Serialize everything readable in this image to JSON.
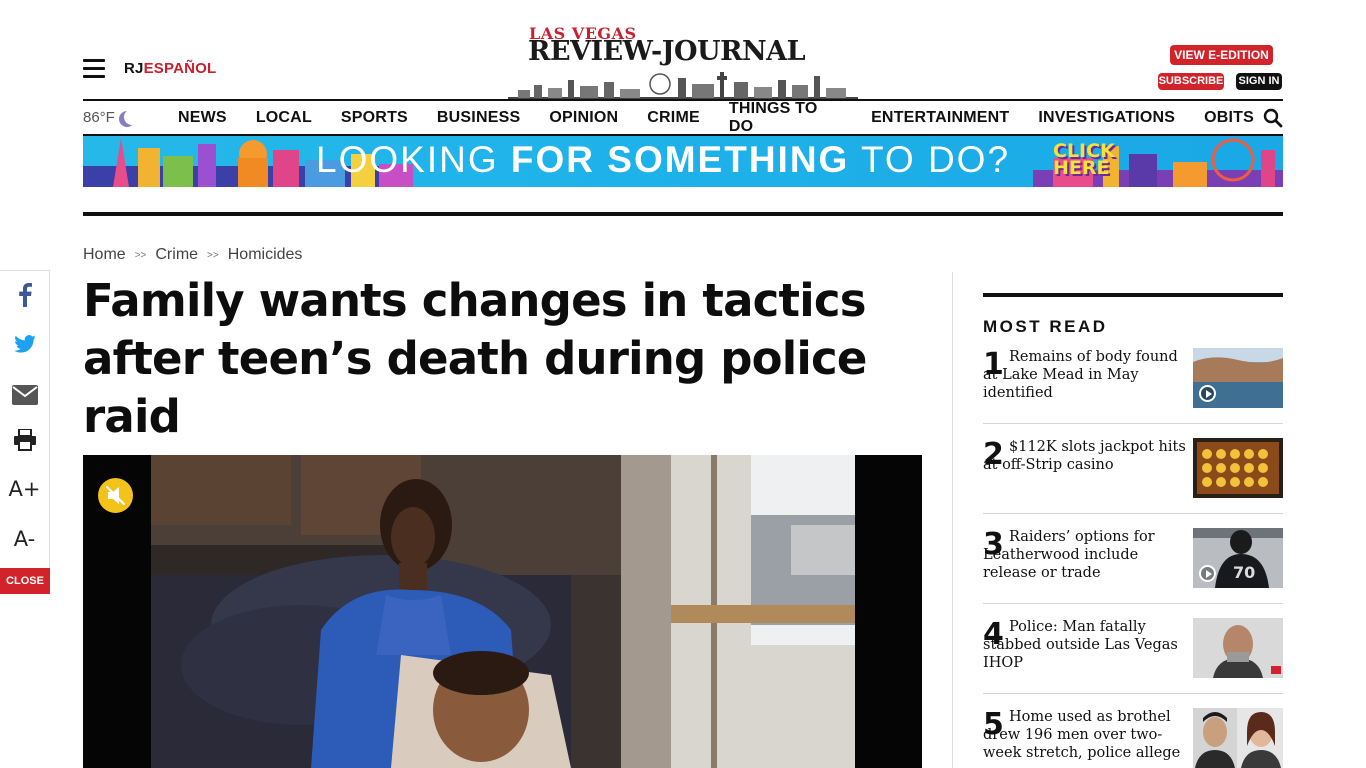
{
  "header": {
    "menu_icon": "hamburger-menu-icon",
    "rj": "RJ",
    "espanol": "ESPAÑOL",
    "logo_top": "LAS VEGAS",
    "logo_main": "REVIEW-JOURNAL",
    "view_eedition": "VIEW E-EDITION",
    "subscribe": "SUBSCRIBE",
    "sign_in": "SIGN IN"
  },
  "nav": {
    "weather": "86°F",
    "weather_icon": "moon-icon",
    "items": [
      "NEWS",
      "LOCAL",
      "SPORTS",
      "BUSINESS",
      "OPINION",
      "CRIME",
      "THINGS TO DO",
      "ENTERTAINMENT",
      "INVESTIGATIONS",
      "OBITS"
    ],
    "search_icon": "search-icon"
  },
  "banner": {
    "text_light_1": "LOOKING ",
    "text_bold": "FOR SOMETHING",
    "text_light_2": " TO DO?",
    "click_line1": "CLICK",
    "click_line2": "HERE"
  },
  "breadcrumb": [
    "Home",
    "Crime",
    "Homicides"
  ],
  "breadcrumb_sep": ">>",
  "article": {
    "headline": "Family wants changes in tactics after teen’s death during police raid"
  },
  "social": {
    "font_up": "A+",
    "font_down": "A-",
    "close": "CLOSE",
    "icons": [
      "facebook-icon",
      "twitter-icon",
      "email-icon",
      "print-icon"
    ]
  },
  "most_read": {
    "title": "MOST READ",
    "items": [
      {
        "num": "1",
        "text": "Remains of body found at Lake Mead in May identified",
        "video": true
      },
      {
        "num": "2",
        "text": "$112K slots jackpot hits at off-Strip casino",
        "video": false
      },
      {
        "num": "3",
        "text": "Raiders’ options for Leatherwood include release or trade",
        "video": true
      },
      {
        "num": "4",
        "text": "Police: Man fatally stabbed outside Las Vegas IHOP",
        "video": false
      },
      {
        "num": "5",
        "text": "Home used as brothel drew 196 men over two-week stretch, police allege",
        "video": false
      }
    ]
  },
  "colors": {
    "brand_red": "#d2232a",
    "banner_blue": "#1fb3ea",
    "mute_yellow": "#f3c31a"
  }
}
